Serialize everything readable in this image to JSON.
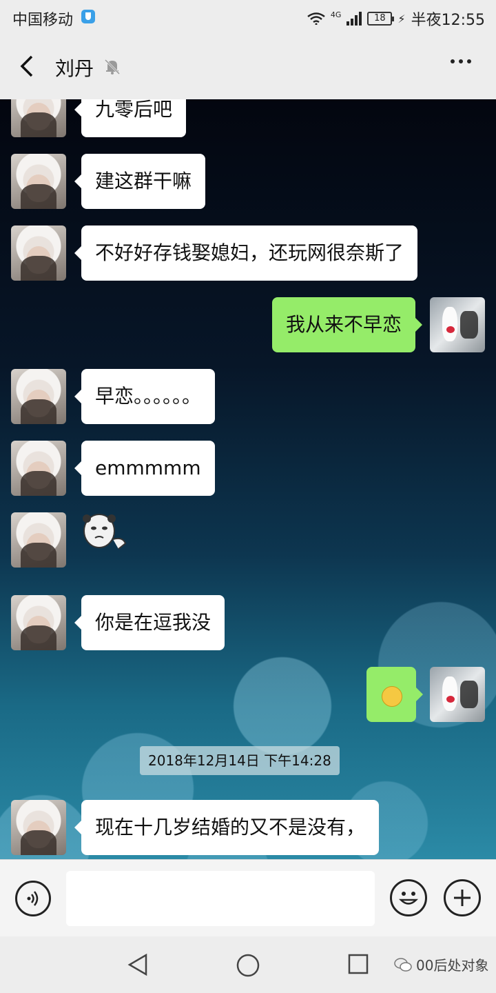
{
  "status_bar": {
    "carrier": "中国移动",
    "network": "4G",
    "battery": "18",
    "time": "半夜12:55"
  },
  "header": {
    "contact_name": "刘丹",
    "more_icon": "more-dots-icon",
    "mute_icon": "muted-bell-icon"
  },
  "messages": [
    {
      "from": "them",
      "text": "九零后吧"
    },
    {
      "from": "them",
      "text": "建这群干嘛"
    },
    {
      "from": "them",
      "text": "不好好存钱娶媳妇，还玩网很奈斯了"
    },
    {
      "from": "me",
      "text": "我从来不早恋"
    },
    {
      "from": "them",
      "text": "早恋。。。。。。"
    },
    {
      "from": "them",
      "text": "emmmmm"
    },
    {
      "from": "them",
      "type": "sticker",
      "icon": "panda-face-sticker"
    },
    {
      "from": "them",
      "text": "你是在逗我没"
    },
    {
      "from": "me",
      "type": "emoji",
      "icon": "confused-emoji"
    },
    {
      "from": "them",
      "text": "现在十几岁结婚的又不是没有，"
    }
  ],
  "timestamp": "2018年12月14日 下午14:28",
  "input_bar": {
    "placeholder": "",
    "voice_icon": "voice-icon",
    "emoji_icon": "smiley-icon",
    "plus_icon": "plus-icon"
  },
  "watermark": "00后处对象",
  "colors": {
    "incoming_bubble": "#ffffff",
    "outgoing_bubble": "#95ec69",
    "bar_background": "#ededed"
  }
}
